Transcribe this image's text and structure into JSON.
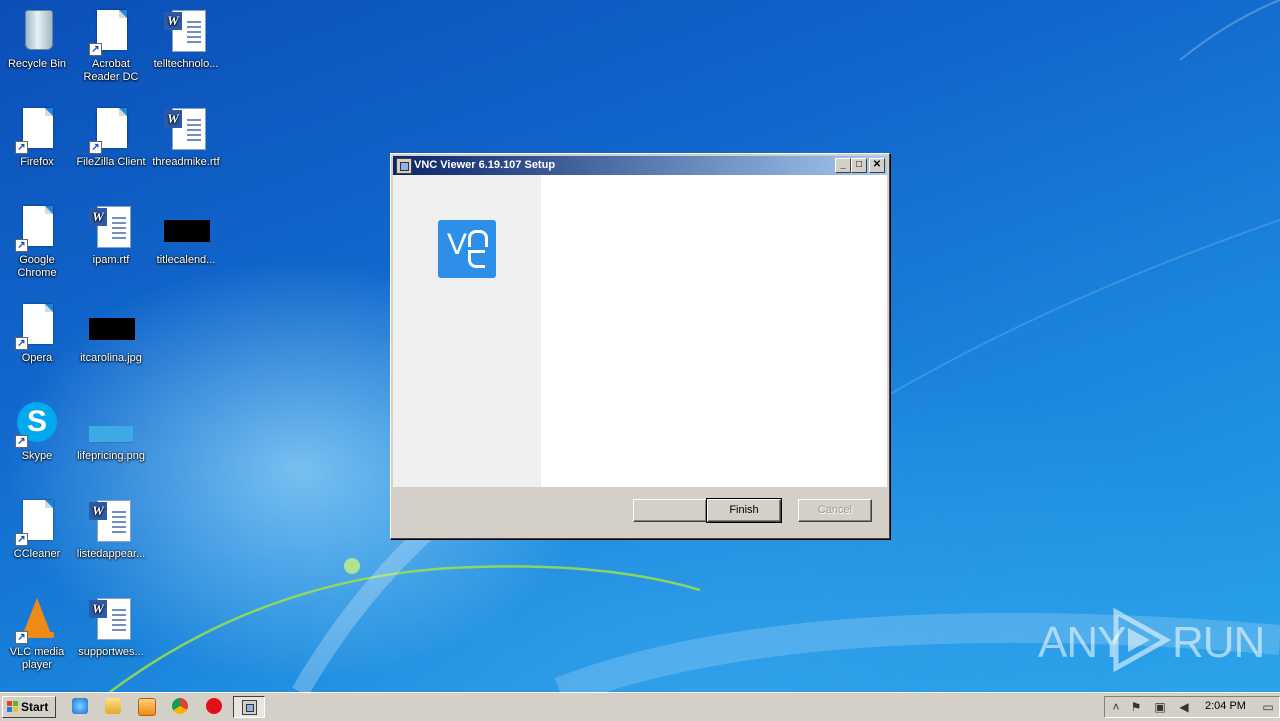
{
  "desktop": {
    "icons": [
      {
        "label": "Recycle Bin"
      },
      {
        "label": "Acrobat Reader DC"
      },
      {
        "label": "telltechnolo..."
      },
      {
        "label": "Firefox"
      },
      {
        "label": "FileZilla Client"
      },
      {
        "label": "threadmike.rtf"
      },
      {
        "label": "Google Chrome"
      },
      {
        "label": "ipam.rtf"
      },
      {
        "label": "titlecalend..."
      },
      {
        "label": "Opera"
      },
      {
        "label": "itcarolina.jpg"
      },
      {
        "label": "Skype"
      },
      {
        "label": "lifepricing.png"
      },
      {
        "label": "CCleaner"
      },
      {
        "label": "listedappear..."
      },
      {
        "label": "VLC media player"
      },
      {
        "label": "supportwes..."
      }
    ]
  },
  "dialog": {
    "title": "VNC Viewer 6.19.107 Setup",
    "logo_letter": "V",
    "buttons": {
      "back": "",
      "finish": "Finish",
      "cancel": "Cancel"
    }
  },
  "watermark": {
    "left": "ANY",
    "right": "RUN"
  },
  "taskbar": {
    "start_label": "Start",
    "clock": "2:04 PM"
  },
  "colors": {
    "accent": "#2d8fe8",
    "titlebar_start": "#0a246a",
    "titlebar_end": "#a6caf0"
  }
}
